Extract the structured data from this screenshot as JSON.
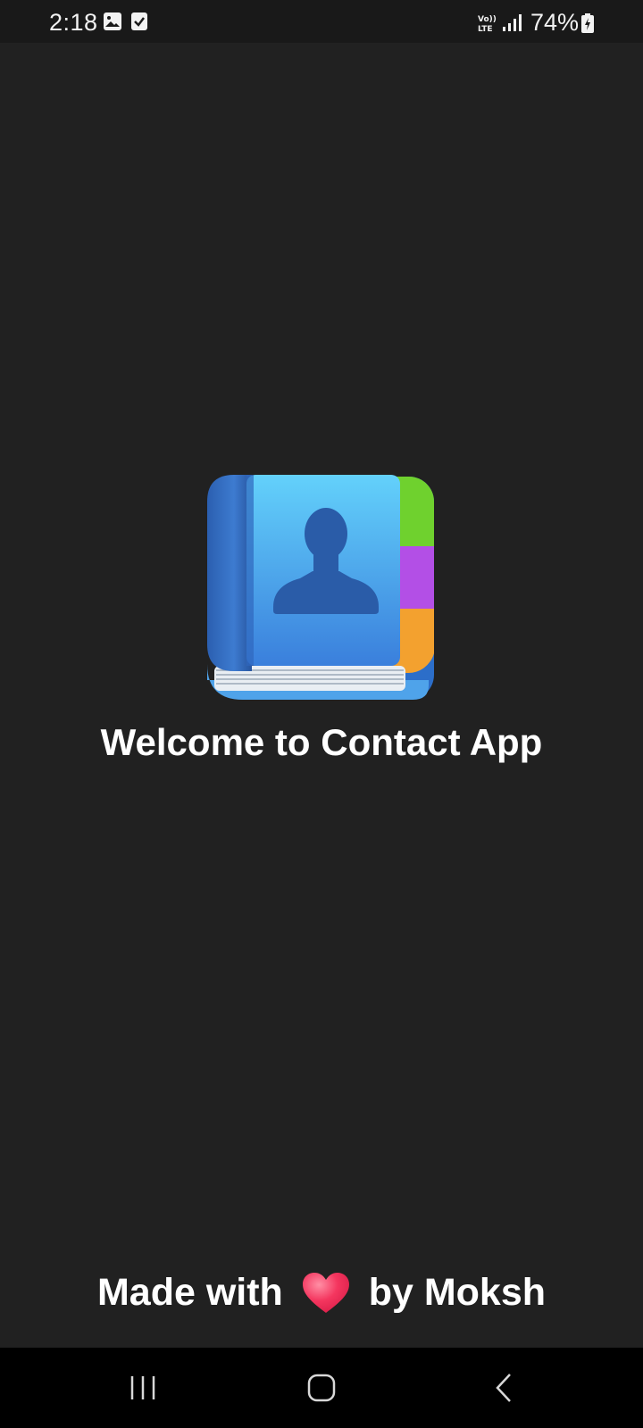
{
  "status_bar": {
    "time": "2:18",
    "notification_icons": [
      "image-icon",
      "checkbox-icon"
    ],
    "network": "Vo) LTE",
    "signal_icon": "signal-icon",
    "battery_percent": "74%",
    "battery_icon": "battery-charging-icon"
  },
  "main": {
    "app_icon": "contact-book-icon",
    "welcome_text": "Welcome to Contact App"
  },
  "footer": {
    "prefix": "Made with",
    "heart_icon": "heart-icon",
    "suffix": "by Moksh"
  },
  "nav_bar": {
    "buttons": [
      "recents-icon",
      "home-icon",
      "back-icon"
    ]
  },
  "colors": {
    "background": "#212121",
    "status_bar": "#191919",
    "nav_bar": "#000000",
    "book_blue": "#3f8fe0",
    "tab_green": "#6fd12e",
    "tab_purple": "#b34fe6",
    "tab_orange": "#f3a12f",
    "heart": "#f4365f"
  }
}
